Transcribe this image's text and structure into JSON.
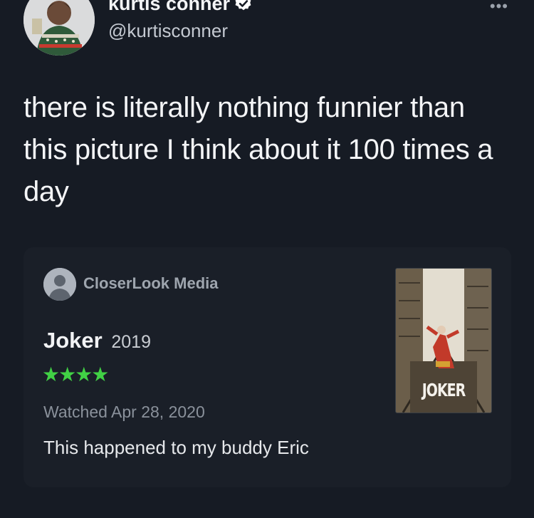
{
  "tweet": {
    "display_name": "kurtis conner",
    "handle": "@kurtisconner",
    "more_label": "•••",
    "text": "there is literally nothing funnier than this picture I think about it 100 times a day",
    "icons": {
      "verified": "verified-badge-icon",
      "more": "more-options-icon"
    }
  },
  "card": {
    "source_name": "CloserLook Media",
    "movie_title": "Joker",
    "movie_year": "2019",
    "rating_stars": "★★★★",
    "rating_value": 4,
    "watched": "Watched Apr 28, 2020",
    "review": "This happened to my buddy Eric",
    "poster_title": "JOKER"
  },
  "colors": {
    "background": "#161b24",
    "card_background": "#1a1f28",
    "star_green": "#41d145",
    "verified_blue": "#ffffff"
  }
}
